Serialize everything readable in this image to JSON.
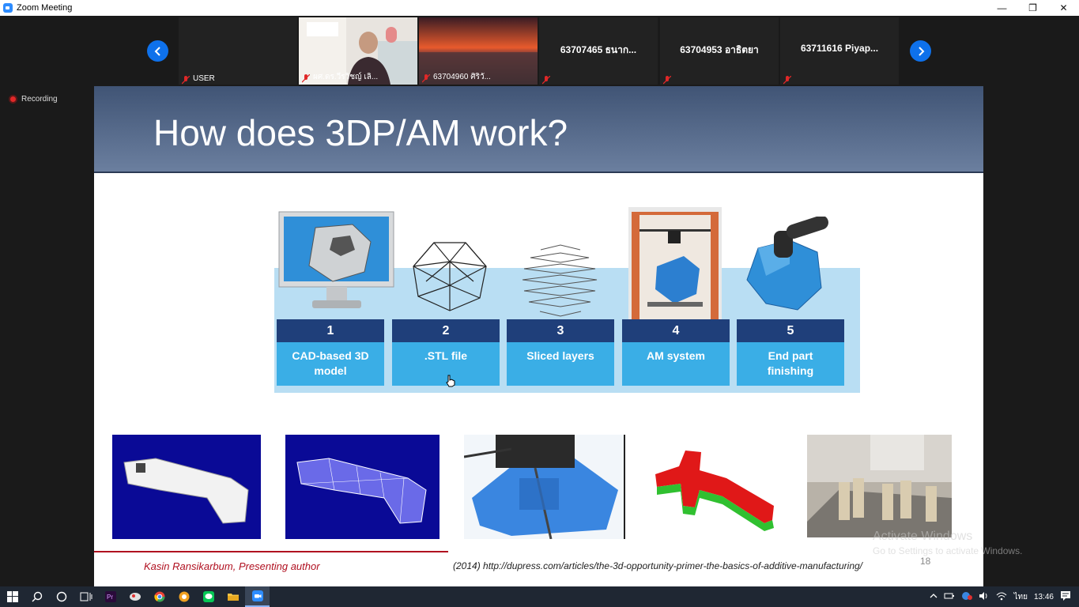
{
  "window": {
    "title": "Zoom Meeting",
    "minimize_glyph": "—",
    "restore_glyph": "❐",
    "close_glyph": "✕"
  },
  "participants": [
    {
      "name": "USER",
      "label": "USER",
      "muted": true,
      "video": false
    },
    {
      "name": "ผศ.ดร.วีรวิชญ์ เลิ...",
      "label": "ผศ.ดร.วีรวิชญ์ เลิ...",
      "muted": true,
      "video": true
    },
    {
      "name": "63704960 ศิริวั...",
      "label": "63704960 ศิริวั...",
      "muted": true,
      "video": true
    },
    {
      "name": "63707465 ธนาก...",
      "label": "",
      "muted": true,
      "video": false
    },
    {
      "name": "63704953 อาธิตยา",
      "label": "",
      "muted": true,
      "video": false
    },
    {
      "name": "63711616 Piyap...",
      "label": "",
      "muted": true,
      "video": false
    }
  ],
  "recording": {
    "label": "Recording"
  },
  "slide": {
    "title": "How does 3DP/AM work?",
    "steps": [
      {
        "num": "1",
        "label": "CAD-based 3D model"
      },
      {
        "num": "2",
        "label": ".STL file"
      },
      {
        "num": "3",
        "label": "Sliced layers"
      },
      {
        "num": "4",
        "label": "AM system"
      },
      {
        "num": "5",
        "label": "End part finishing"
      }
    ],
    "author": "Kasin Ransikarbum, Presenting author",
    "citation": "(2014) http://dupress.com/articles/the-3d-opportunity-primer-the-basics-of-additive-manufacturing/",
    "page_number": "18"
  },
  "watermark": {
    "line1": "Activate Windows",
    "line2": "Go to Settings to activate Windows."
  },
  "taskbar": {
    "items": [
      "windows-start",
      "search",
      "cortana",
      "task-view",
      "premiere",
      "app",
      "chrome",
      "app-orange",
      "line",
      "file-explorer",
      "zoom"
    ],
    "language": "ไทย",
    "time": "13:46"
  },
  "colors": {
    "accent": "#0e71eb",
    "header": "#405475",
    "step_number": "#1f3f7a",
    "step_label": "#3aaee6",
    "recording": "#e02828"
  }
}
